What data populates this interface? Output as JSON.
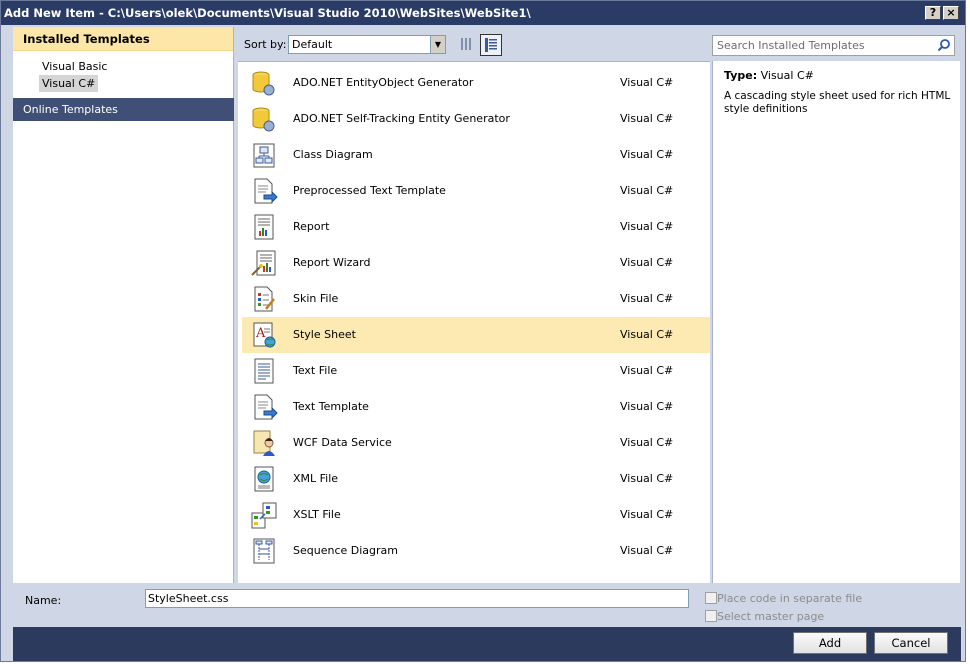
{
  "window": {
    "title": "Add New Item - C:\\Users\\olek\\Documents\\Visual Studio 2010\\WebSites\\WebSite1\\",
    "help_label": "?",
    "close_label": "×"
  },
  "sidebar": {
    "installed_header": "Installed Templates",
    "items": [
      {
        "label": "Visual Basic",
        "selected": false
      },
      {
        "label": "Visual C#",
        "selected": true
      }
    ],
    "online_label": "Online Templates"
  },
  "toolbar": {
    "sort_label": "Sort by:",
    "sort_value": "Default",
    "search_placeholder": "Search Installed Templates"
  },
  "templates": [
    {
      "name": "ADO.NET EntityObject Generator",
      "lang": "Visual C#",
      "icon": "database-gear-icon"
    },
    {
      "name": "ADO.NET Self-Tracking Entity Generator",
      "lang": "Visual C#",
      "icon": "database-gear-icon"
    },
    {
      "name": "Class Diagram",
      "lang": "Visual C#",
      "icon": "class-diagram-icon"
    },
    {
      "name": "Preprocessed Text Template",
      "lang": "Visual C#",
      "icon": "text-template-icon"
    },
    {
      "name": "Report",
      "lang": "Visual C#",
      "icon": "report-icon"
    },
    {
      "name": "Report Wizard",
      "lang": "Visual C#",
      "icon": "report-wizard-icon"
    },
    {
      "name": "Skin File",
      "lang": "Visual C#",
      "icon": "skin-file-icon"
    },
    {
      "name": "Style Sheet",
      "lang": "Visual C#",
      "icon": "stylesheet-icon",
      "selected": true
    },
    {
      "name": "Text File",
      "lang": "Visual C#",
      "icon": "text-file-icon"
    },
    {
      "name": "Text Template",
      "lang": "Visual C#",
      "icon": "text-template-icon"
    },
    {
      "name": "WCF Data Service",
      "lang": "Visual C#",
      "icon": "wcf-service-icon"
    },
    {
      "name": "XML File",
      "lang": "Visual C#",
      "icon": "xml-file-icon"
    },
    {
      "name": "XSLT File",
      "lang": "Visual C#",
      "icon": "xslt-file-icon"
    },
    {
      "name": "Sequence Diagram",
      "lang": "Visual C#",
      "icon": "sequence-diagram-icon"
    }
  ],
  "details": {
    "type_label": "Type:",
    "type_value": "Visual C#",
    "description": "A cascading style sheet used for rich HTML style definitions"
  },
  "form": {
    "name_label": "Name:",
    "name_value": "StyleSheet.css",
    "separate_file_label": "Place code in separate file",
    "master_page_label": "Select master page"
  },
  "buttons": {
    "add": "Add",
    "cancel": "Cancel"
  }
}
